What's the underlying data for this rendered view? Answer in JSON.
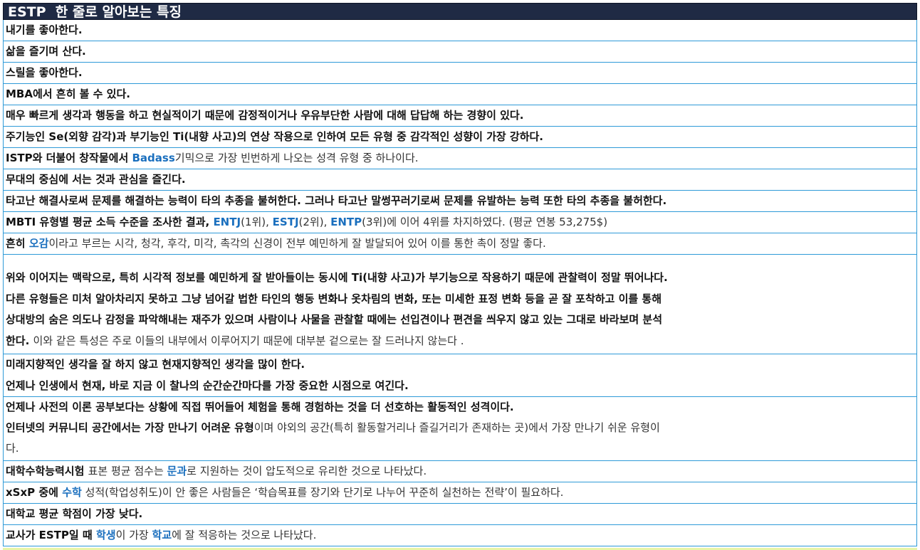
{
  "title": "ESTP  한 줄로 알아보는 특징",
  "rows": [
    {
      "segments": [
        {
          "t": "내기를 좋아한다.",
          "s": "b"
        }
      ]
    },
    {
      "segments": [
        {
          "t": "삶을 즐기며 산다.",
          "s": "b"
        }
      ]
    },
    {
      "segments": [
        {
          "t": "스릴을 좋아한다.",
          "s": "b"
        }
      ]
    },
    {
      "segments": [
        {
          "t": "MBA에서 흔히 볼 수 있다.",
          "s": "b"
        }
      ]
    },
    {
      "segments": [
        {
          "t": "매우 빠르게 생각과 행동을 하고 현실적이기 때문에 감정적이거나 우유부단한 사람에 대해 답답해 하는 경향이 있다.",
          "s": "b"
        }
      ]
    },
    {
      "segments": [
        {
          "t": "주기능인 Se(외향 감각)과 부기능인 Ti(내향 사고)의 연상 작용으로 인하여 모든 유형 중 감각적인 성향이 가장 강하다.",
          "s": "b"
        }
      ]
    },
    {
      "segments": [
        {
          "t": "ISTP와 더불어 창작물에서 ",
          "s": "b"
        },
        {
          "t": "Badass",
          "s": "hl"
        },
        {
          "t": "기믹으로 가장 빈번하게 나오는 성격 유형 중 하나이다.",
          "s": "n"
        }
      ]
    },
    {
      "segments": [
        {
          "t": "무대의 중심에 서는 것과 관심을 즐긴다.",
          "s": "b"
        }
      ]
    },
    {
      "segments": [
        {
          "t": "타고난 해결사로써 문제를 해결하는 능력이 타의 추종을 불허한다. 그러나 타고난 말썽꾸러기로써 문제를 유발하는 능력 또한 타의 추종을 불허한다.",
          "s": "b"
        }
      ]
    },
    {
      "segments": [
        {
          "t": "MBTI 유형별 평균 소득 수준을 조사한 결과, ",
          "s": "b"
        },
        {
          "t": "ENTJ",
          "s": "hl"
        },
        {
          "t": "(1위), ",
          "s": "n"
        },
        {
          "t": "ESTJ",
          "s": "hl"
        },
        {
          "t": "(2위), ",
          "s": "n"
        },
        {
          "t": "ENTP",
          "s": "hl"
        },
        {
          "t": "(3위)에 이어 4위를 차지하였다. (평균 연봉 53,275$)",
          "s": "n"
        }
      ]
    },
    {
      "segments": [
        {
          "t": "흔히 ",
          "s": "b"
        },
        {
          "t": "오감",
          "s": "hl"
        },
        {
          "t": "이라고 부르는 시각, 청각, 후각, 미각, 촉각의 신경이 전부 예민하게 잘 발달되어 있어 이를 통한 촉이 정말 좋다.",
          "s": "n"
        }
      ]
    }
  ],
  "paragraph": [
    [
      {
        "t": "위와 이어지는 맥락으로, 특히 시각적 정보를 예민하게 잘 받아들이는 동시에 Ti(내향 사고)가 부기능으로 작용하기 때문에 관찰력이 정말 뛰어나다.",
        "s": "b"
      }
    ],
    [
      {
        "t": "다른 유형들은 미처 알아차리지 못하고 그냥 넘어갈 법한 타인의 행동 변화나 옷차림의 변화, 또는 미세한 표정 변화 등을 곧 잘 포착하고 이를 통해",
        "s": "b"
      }
    ],
    [
      {
        "t": "상대방의 숨은 의도나 감정을 파악해내는 재주가 있으며 사람이나 사물을 관찰할 때에는 선입견이나 편견을 씌우지 않고 있는 그대로 바라보며 분석",
        "s": "b"
      }
    ],
    [
      {
        "t": "한다. ",
        "s": "b"
      },
      {
        "t": "이와 같은 특성은 주로 이들의 내부에서 이루어지기 때문에 대부분 겉으로는 잘 드러나지 않는다 .",
        "s": "n"
      }
    ]
  ],
  "pair1": [
    [
      {
        "t": "미래지향적인 생각을 잘 하지 않고 현재지향적인 생각을 많이 한다.",
        "s": "b"
      }
    ],
    [
      {
        "t": "언제나 인생에서 현재, 바로 지금 이 찰나의 순간순간마다를 가장 중요한 시점으로 여긴다.",
        "s": "b"
      }
    ]
  ],
  "triple": [
    [
      {
        "t": "언제나 사전의 이론 공부보다는 상황에 직접 뛰어들어 체험을 통해 경험하는 것을 더 선호하는 활동적인 성격이다.",
        "s": "b"
      }
    ],
    [
      {
        "t": "인터넷의 커뮤니티 공간에서는 가장 만나기 어려운 유형",
        "s": "b"
      },
      {
        "t": "이며 야외의 공간(특히 활동할거리나 즐길거리가 존재하는 곳)에서 가장 만나기 쉬운 유형이",
        "s": "n"
      }
    ],
    [
      {
        "t": "다.",
        "s": "n"
      }
    ]
  ],
  "tail": [
    {
      "segments": [
        {
          "t": "대학수학능력시험 ",
          "s": "b"
        },
        {
          "t": "표본 평균 점수는 ",
          "s": "n"
        },
        {
          "t": "문과",
          "s": "hl"
        },
        {
          "t": "로 지원하는 것이 압도적으로 유리한 것으로 나타났다.",
          "s": "n"
        }
      ]
    },
    {
      "segments": [
        {
          "t": "xSxP 중에 ",
          "s": "b"
        },
        {
          "t": "수학",
          "s": "hl"
        },
        {
          "t": " 성적(학업성취도)이 안 좋은 사람들은 ‘학습목표를 장기와 단기로 나누어 꾸준히 실천하는 전략’이 필요하다.",
          "s": "n"
        }
      ]
    },
    {
      "segments": [
        {
          "t": "대학교 평균 학점이 가장 낮다.",
          "s": "b"
        }
      ]
    },
    {
      "segments": [
        {
          "t": "교사가 ESTP일 때 ",
          "s": "b"
        },
        {
          "t": "학생",
          "s": "hl"
        },
        {
          "t": "이 가장 ",
          "s": "n"
        },
        {
          "t": "학교",
          "s": "hl"
        },
        {
          "t": "에 잘 적응하는 것으로 나타났다.",
          "s": "n"
        }
      ]
    }
  ],
  "colors": {
    "header_bg": "#1f2a44",
    "border": "#2e9ad8",
    "highlight": "#1a6fbe"
  }
}
